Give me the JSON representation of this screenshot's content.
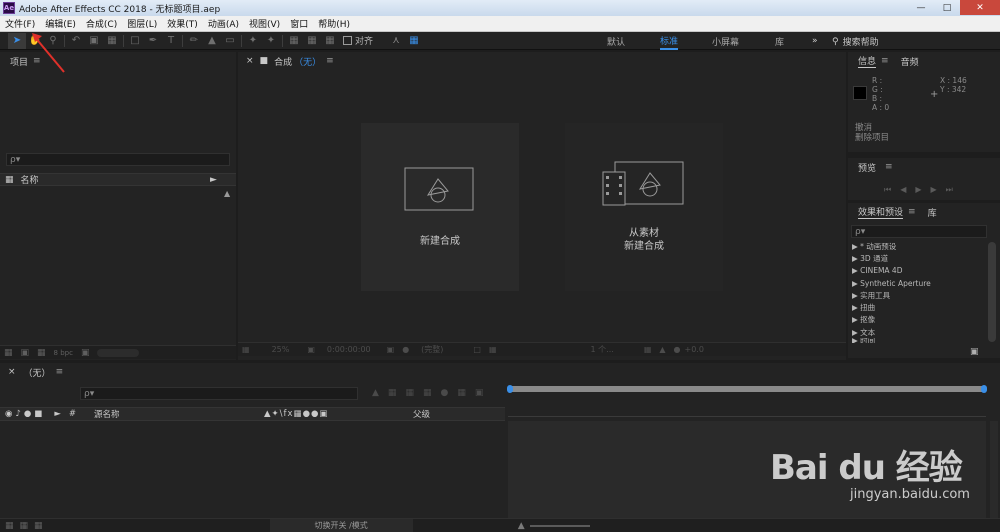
{
  "window": {
    "title": "Adobe After Effects CC 2018 - 无标题项目.aep",
    "app_icon": "Ae",
    "controls": [
      "minimize",
      "maximize",
      "close"
    ]
  },
  "menu": [
    "文件(F)",
    "编辑(E)",
    "合成(C)",
    "图层(L)",
    "效果(T)",
    "动画(A)",
    "视图(V)",
    "窗口",
    "帮助(H)"
  ],
  "toolbar": {
    "align_label": "对齐",
    "workspaces": [
      "默认",
      "标准",
      "小屏幕",
      "库"
    ],
    "active_workspace": "标准",
    "more": "»",
    "search_help": "搜索帮助"
  },
  "project_panel": {
    "title": "项目",
    "search_placeholder": "ρ▾",
    "col_name": "名称",
    "bpc": "8 bpc"
  },
  "comp_panel": {
    "tab_label": "合成",
    "tab_value": "（无）",
    "new_comp_label": "新建合成",
    "from_footage_line1": "从素材",
    "from_footage_line2": "新建合成",
    "zoom": "25%",
    "timecode": "0:00:00:00",
    "resolution": "(完整)",
    "views": "1 个...",
    "exposure": "+0.0"
  },
  "info_panel": {
    "tab_info": "信息",
    "tab_audio": "音频",
    "r": "R :",
    "g": "G :",
    "b": "B :",
    "a": "A : 0",
    "x": "X : 146",
    "y": "Y : 342",
    "undo": "撤消",
    "delete": "删除项目"
  },
  "preview_panel": {
    "title": "预览"
  },
  "effects_panel": {
    "tab_effects": "效果和预设",
    "tab_library": "库",
    "search_placeholder": "ρ▾",
    "items": [
      "▶ * 动画预设",
      "▶ 3D 通道",
      "▶ CINEMA 4D",
      "▶ Synthetic Aperture",
      "▶ 实用工具",
      "▶ 扭曲",
      "▶ 抠像",
      "▶ 文本",
      "▶ 时间"
    ]
  },
  "timeline_panel": {
    "tab_label": "（无）",
    "search_placeholder": "ρ▾",
    "col_source_name": "源名称",
    "col_parent": "父级",
    "toggle_label": "切换开关 /模式"
  },
  "watermark": {
    "logo": "Bai du 经验",
    "url": "jingyan.baidu.com"
  },
  "colors": {
    "accent": "#3a8fe8",
    "panel_bg": "#232323",
    "arrow_annotation": "#e0302a"
  }
}
